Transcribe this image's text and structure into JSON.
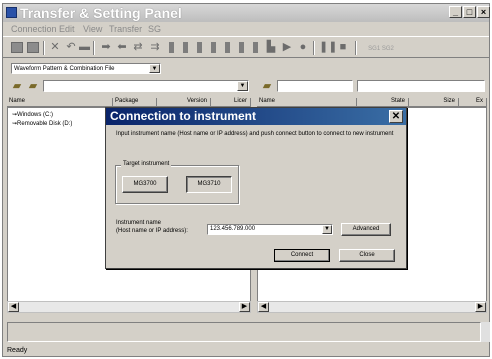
{
  "app": {
    "title": "Transfer & Setting Panel",
    "window_buttons": [
      "_",
      "□",
      "×"
    ]
  },
  "menu": [
    "Connection",
    "Edit",
    "View",
    "Transfer",
    "SG"
  ],
  "toolbar": {
    "icons": [
      "connect-icon",
      "disconnect-icon",
      "delete-icon",
      "undo-icon",
      "copy-icon",
      "transfer-right-icon",
      "transfer-left-icon",
      "transfer-both-icon",
      "equals-icon",
      "bar-chart-icons",
      "play-icon",
      "record-icon",
      "pause-icon",
      "stop-icon"
    ],
    "sg_labels": "SG1 SG2"
  },
  "file_type": {
    "value": "Waveform Pattern & Combination File"
  },
  "left_pane": {
    "columns": [
      "Name",
      "Package",
      "Version",
      "Licer"
    ],
    "items": [
      "Windows (C:)",
      "Removable Disk (D:)"
    ]
  },
  "right_pane": {
    "columns": [
      "Name",
      "State",
      "Size",
      "Ex"
    ]
  },
  "status": {
    "text": "Ready"
  },
  "dialog": {
    "title": "Connection to instrument",
    "instruction": "Input instrument name (Host name or IP address) and push connect button to connect to new instrument",
    "target_group_label": "Target instrument",
    "instrument_buttons": [
      "MG3700",
      "MG3710"
    ],
    "selected_instrument": "MG3710",
    "field_label_line1": "Instrument name",
    "field_label_line2": "(Host name or IP address):",
    "instrument_name_value": "123.456.789.000",
    "advanced_label": "Advanced",
    "connect_label": "Connect",
    "close_label": "Close"
  }
}
